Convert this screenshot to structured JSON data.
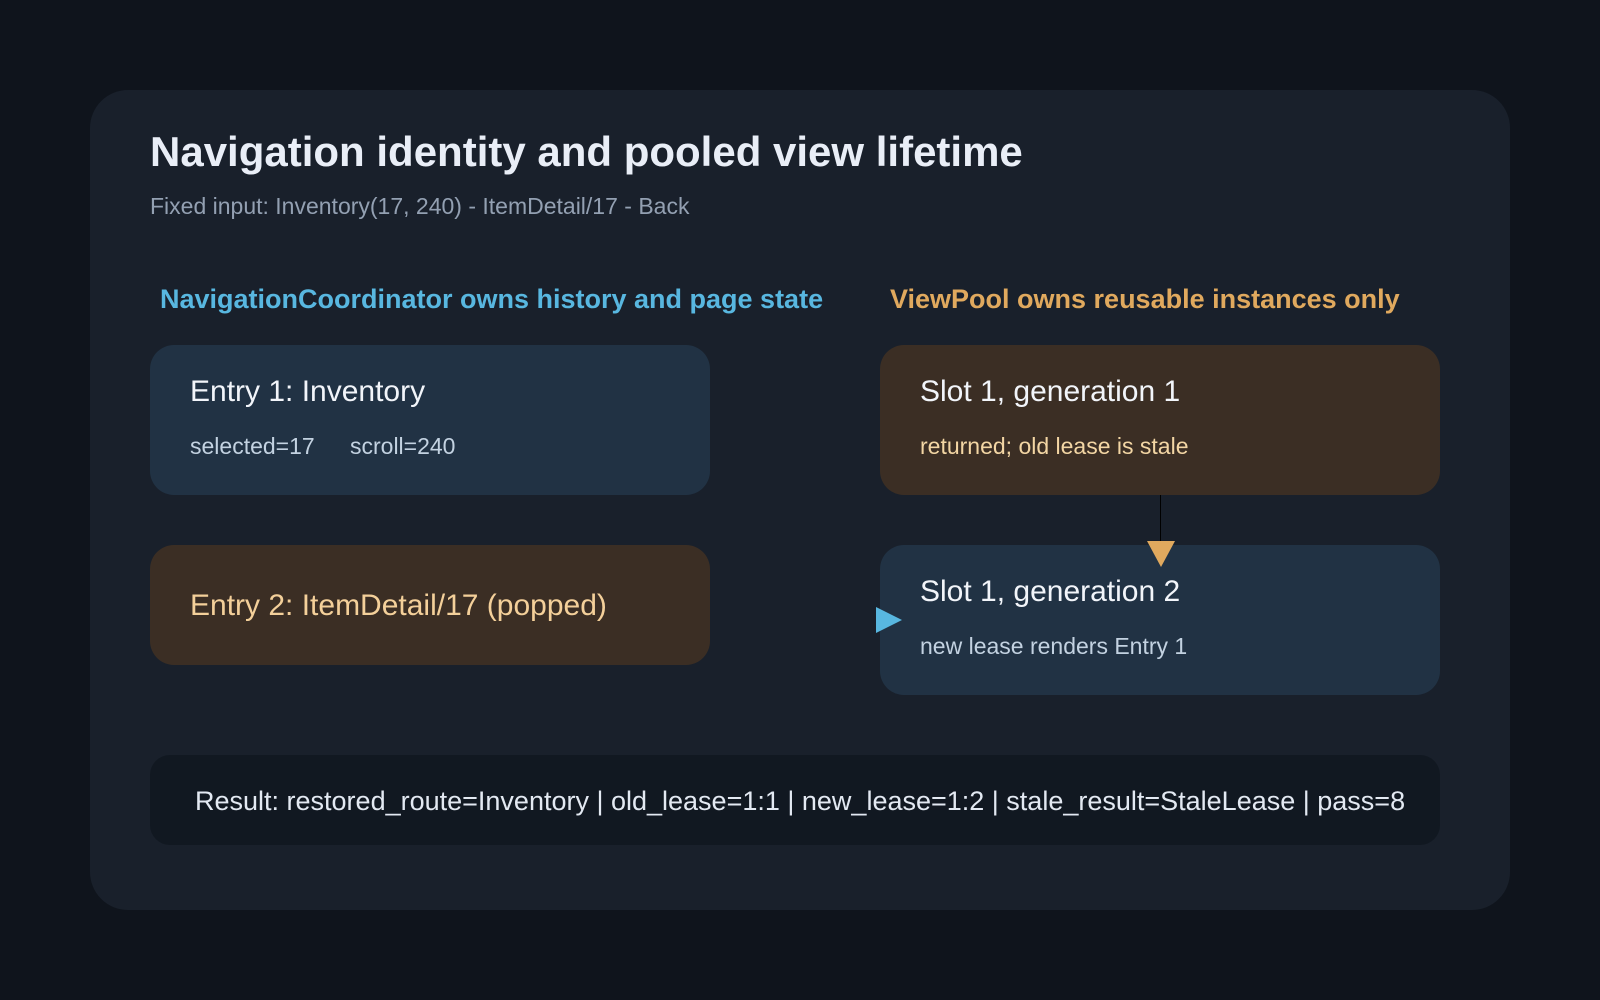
{
  "title": "Navigation identity and pooled view lifetime",
  "subtitle": "Fixed input: Inventory(17, 240) - ItemDetail/17 - Back",
  "colors": {
    "background": "#0f141c",
    "panel": "#19202b",
    "coordinator_accent": "#58b7e0",
    "pool_accent": "#e0a95e",
    "blue_box": "#213244",
    "brown_box": "#3b2e24",
    "result_box": "#111821"
  },
  "coordinator": {
    "heading": "NavigationCoordinator owns history and page state",
    "entries": [
      {
        "title": "Entry 1: Inventory",
        "selected": "selected=17",
        "scroll": "scroll=240"
      },
      {
        "title": "Entry 2: ItemDetail/17 (popped)"
      }
    ]
  },
  "pool": {
    "heading": "ViewPool owns reusable instances only",
    "slots": [
      {
        "title": "Slot 1, generation 1",
        "note": "returned; old lease is stale"
      },
      {
        "title": "Slot 1, generation 2",
        "note": "new lease renders Entry 1"
      }
    ]
  },
  "result": "Result: restored_route=Inventory | old_lease=1:1 | new_lease=1:2 | stale_result=StaleLease | pass=8"
}
